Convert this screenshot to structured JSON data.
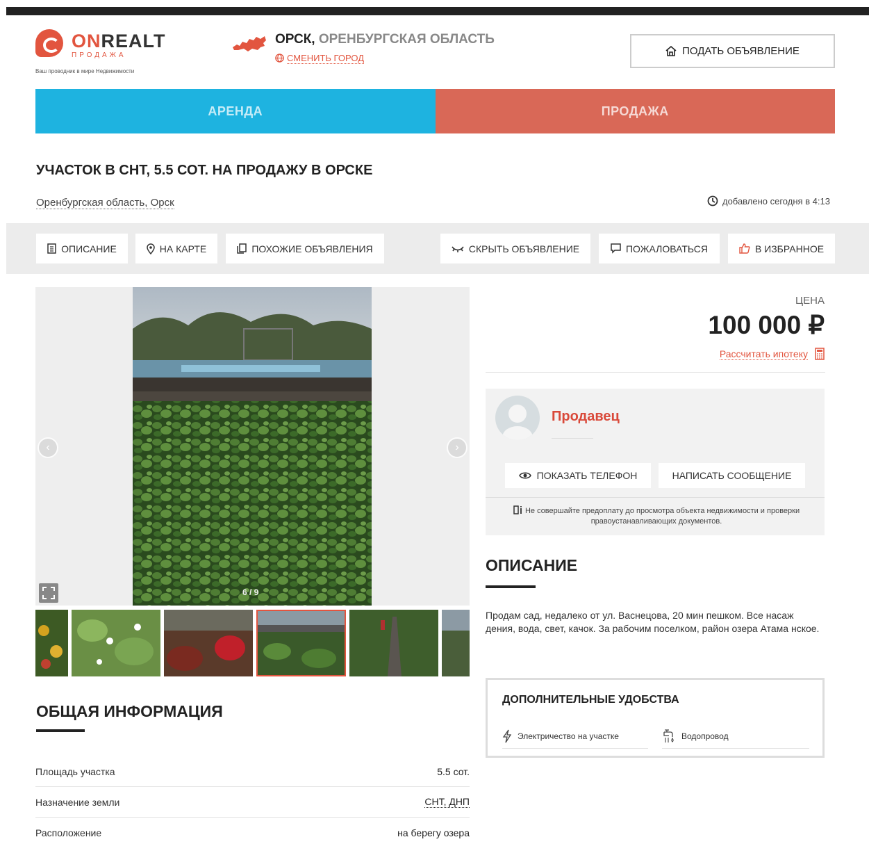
{
  "header": {
    "logo_name_accent": "ON",
    "logo_name_rest": "REALT",
    "logo_sub": "ПРОДАЖА",
    "logo_tagline": "Ваш проводник в мире Недвижимости",
    "city": "ОРСК,",
    "region": "ОРЕНБУРГСКАЯ ОБЛАСТЬ",
    "change_city": "СМЕНИТЬ ГОРОД",
    "post_ad": "ПОДАТЬ ОБЪЯВЛЕНИЕ"
  },
  "tabs": {
    "rent": "АРЕНДА",
    "sale": "ПРОДАЖА"
  },
  "listing": {
    "title": "УЧАСТОК В СНТ, 5.5 СОТ. НА ПРОДАЖУ В ОРСКЕ",
    "location": "Оренбургская область, Орск",
    "added": "добавлено сегодня в 4:13"
  },
  "actions": {
    "description": "ОПИСАНИЕ",
    "map": "НА КАРТЕ",
    "similar": "ПОХОЖИЕ ОБЪЯВЛЕНИЯ",
    "hide": "СКРЫТЬ ОБЪЯВЛЕНИЕ",
    "complain": "ПОЖАЛОВАТЬСЯ",
    "favorite": "В ИЗБРАННОЕ"
  },
  "gallery": {
    "counter": "6 / 9"
  },
  "price": {
    "label": "ЦЕНА",
    "value": "100 000 ₽",
    "mortgage": "Рассчитать ипотеку"
  },
  "seller": {
    "name": "Продавец",
    "show_phone": "ПОКАЗАТЬ ТЕЛЕФОН",
    "message": "НАПИСАТЬ СООБЩЕНИЕ",
    "warning": "Не совершайте предоплату до просмотра объекта недвижимости и проверки правоустанавливающих документов."
  },
  "description": {
    "heading": "ОПИСАНИЕ",
    "text": "Продам сад, недалеко от ул. Васнецова, 20 мин пешком. Все насаж дения, вода, свет, качок. За рабочим поселком, район озера Атама нское."
  },
  "extras": {
    "heading": "ДОПОЛНИТЕЛЬНЫЕ УДОБСТВА",
    "items": [
      "Электричество на участке",
      "Водопровод"
    ]
  },
  "general": {
    "heading": "ОБЩАЯ ИНФОРМАЦИЯ",
    "rows": [
      {
        "label": "Площадь участка",
        "value": "5.5 сот."
      },
      {
        "label": "Назначение земли",
        "value": "СНТ, ДНП"
      },
      {
        "label": "Расположение",
        "value": "на берегу озера"
      }
    ]
  },
  "colors": {
    "accent": "#e2553f",
    "rent_tab": "#1eb3e0",
    "sale_tab": "#d96857"
  }
}
